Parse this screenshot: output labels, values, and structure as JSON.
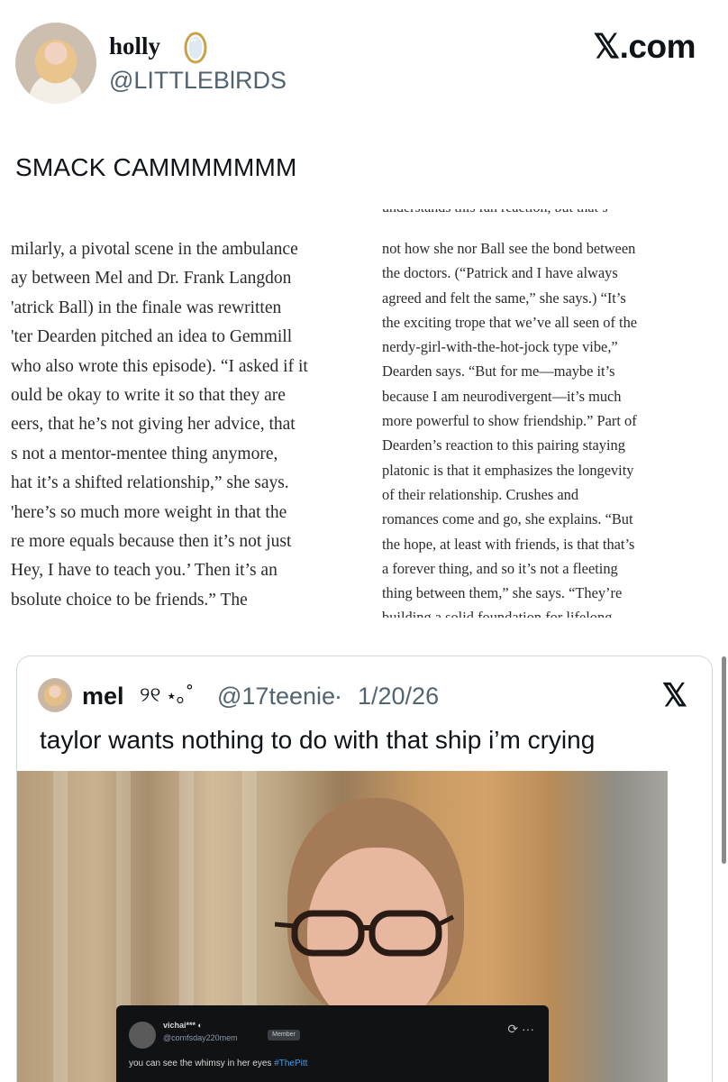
{
  "header": {
    "display_name": "holly",
    "handle": "@LITTLEBlRDS",
    "brand": "𝕏.com",
    "name_icon": "mirror-icon"
  },
  "tweet": {
    "text": "SMACK CAMMMMMMM"
  },
  "article": {
    "left_lines": [
      "milarly, a pivotal scene in the ambulance",
      "ay between Mel and Dr. Frank Langdon",
      "'atrick Ball) in the finale was rewritten",
      "'ter Dearden pitched an idea to Gemmill",
      "who also wrote this episode). “I asked if it",
      "ould be okay to write it so that they are",
      "eers, that he’s not giving her advice, that",
      "s not a mentor-mentee thing anymore,",
      "hat it’s a shifted relationship,” she says.",
      "'here’s so much more weight in that the",
      "re more equals because then it’s not just",
      "Hey, I have to teach you.’ Then it’s an",
      "bsolute choice to be friends.” The"
    ],
    "right_top_cut": "understands this fan reaction, but that’s",
    "right_lines": [
      "not how she nor Ball see the bond between",
      "the doctors. (“Patrick and I have always",
      "agreed and felt the same,” she says.) “It’s",
      "the exciting trope that we’ve all seen of the",
      "nerdy-girl-with-the-hot-jock type vibe,”",
      "Dearden says. “But for me—maybe it’s",
      "because I am neurodivergent—it’s much",
      "more powerful to show friendship.” Part of",
      "Dearden’s reaction to this pairing staying",
      "platonic is that it emphasizes the longevity",
      "of their relationship. Crushes and",
      "romances come and go, she explains. “But",
      "the hope, at least with friends, is that that’s",
      "a forever thing, and so it’s not a fleeting",
      "thing between them,” she says. “They’re"
    ],
    "right_bottom_cut": "building a solid foundation for lifelong"
  },
  "quote": {
    "name": "mel",
    "decoration": "୨୧ ⋆｡˚",
    "handle": "@17teenie",
    "separator": "·",
    "date": "1/20/26",
    "logo": "𝕏",
    "text": "taylor wants nothing to do with that ship i’m crying"
  },
  "media_overlay": {
    "user": "vichai*** ◐",
    "handle": "@comfsday220mem",
    "pill": "Member",
    "icons": "⟳ ···",
    "caption": "you can see the whimsy in her eyes",
    "hashtag": "#ThePitt"
  },
  "colors": {
    "text": "#0f1419",
    "secondary": "#536471",
    "border": "#cfd9de",
    "link": "#4a9de8"
  }
}
